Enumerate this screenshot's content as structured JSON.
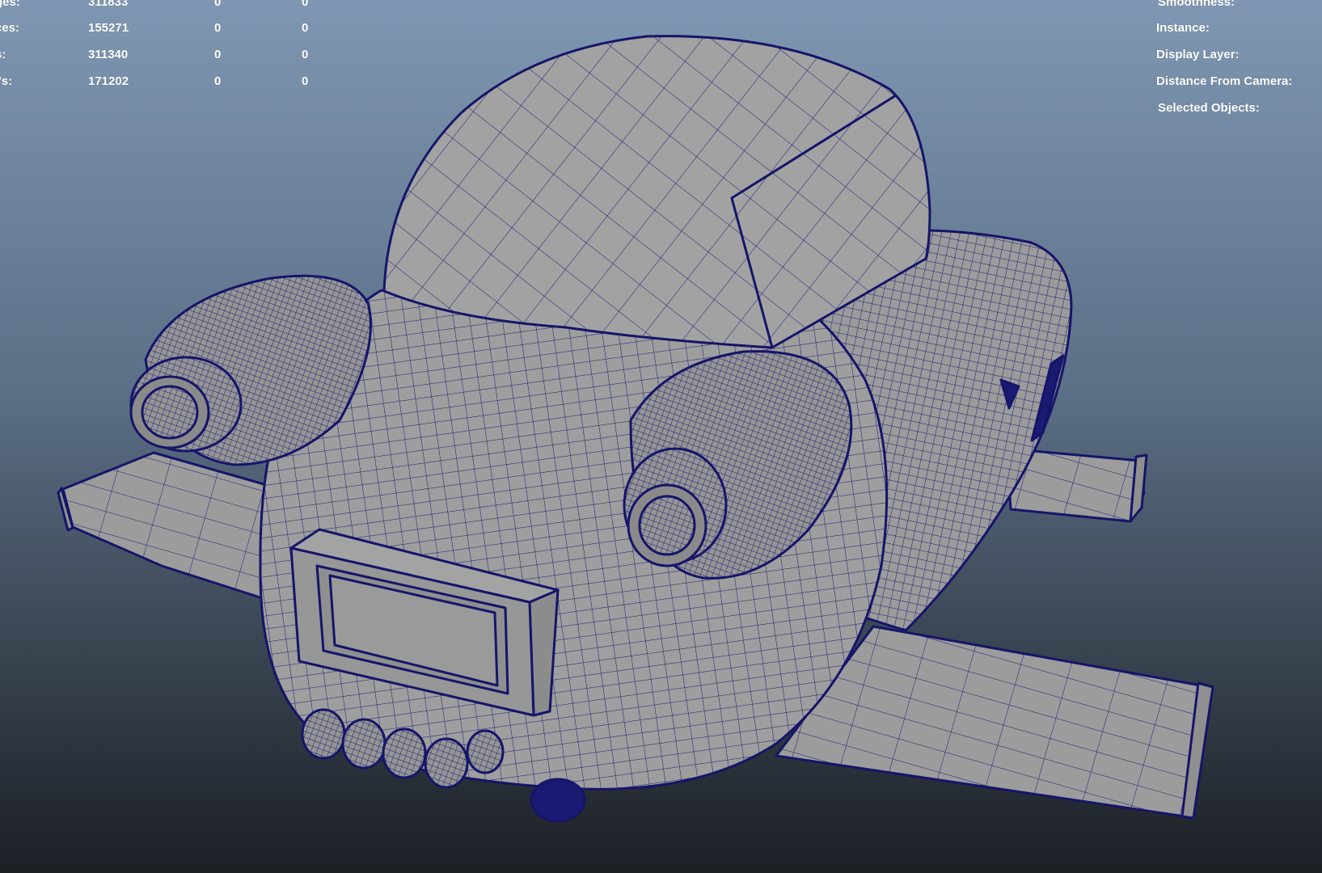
{
  "viewport": {
    "background_top": "#7f97b2",
    "background_bottom": "#1c1f24",
    "mesh_fill": "#9a9a9a",
    "wire_color": "#1a1a72"
  },
  "poly_count": {
    "rows": [
      {
        "label": "ges:",
        "total": "311833",
        "selected": "0",
        "component": "0"
      },
      {
        "label": "ces:",
        "total": "155271",
        "selected": "0",
        "component": "0"
      },
      {
        "label": "s:",
        "total": "311340",
        "selected": "0",
        "component": "0"
      },
      {
        "label": "/'s:",
        "total": "171202",
        "selected": "0",
        "component": "0"
      }
    ]
  },
  "object_info": {
    "rows": [
      {
        "label": "Smoothness:"
      },
      {
        "label": "Instance:"
      },
      {
        "label": "Display Layer:"
      },
      {
        "label": "Distance From Camera:"
      },
      {
        "label": "Selected Objects:"
      }
    ]
  }
}
